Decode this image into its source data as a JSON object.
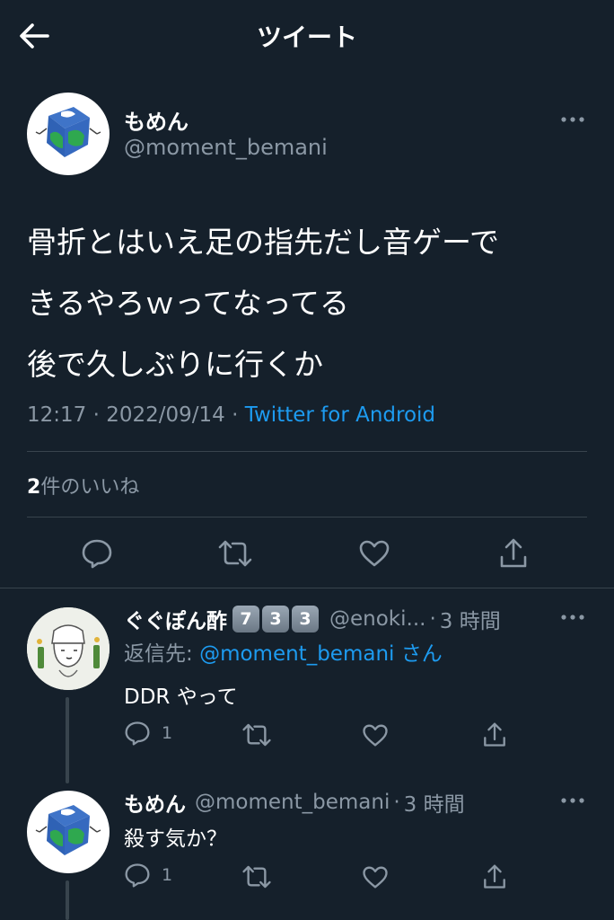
{
  "header": {
    "title": "ツイート"
  },
  "tweet": {
    "display_name": "もめん",
    "handle": "@moment_bemani",
    "text_line1": "骨折とはいえ足の指先だし音ゲーで",
    "text_line2": "きるやろｗってなってる",
    "text_line3": "後で久しぶりに行くか",
    "time": "12:17",
    "sep1": " · ",
    "date": "2022/09/14",
    "sep2": " · ",
    "source": "Twitter for Android",
    "likes_count": "2",
    "likes_label": "件のいいね"
  },
  "replies": [
    {
      "display_name": "ぐぐぽん酢",
      "badges": [
        "7",
        "3",
        "3"
      ],
      "handle": "@enoki...",
      "time_sep": "·",
      "time": "3 時間",
      "reply_to_label": "返信先: ",
      "reply_to_handle": "@moment_bemani",
      "reply_to_suffix": " さん",
      "text": "DDR やって",
      "reply_count": "1"
    },
    {
      "display_name": "もめん",
      "handle": "@moment_bemani",
      "time_sep": "·",
      "time": "3 時間",
      "text": "殺す気か？",
      "reply_count": "1"
    }
  ],
  "colors": {
    "background": "#15202b",
    "text": "#ffffff",
    "muted": "#8b98a5",
    "link": "#1d9bf0",
    "divider": "#38444d"
  }
}
